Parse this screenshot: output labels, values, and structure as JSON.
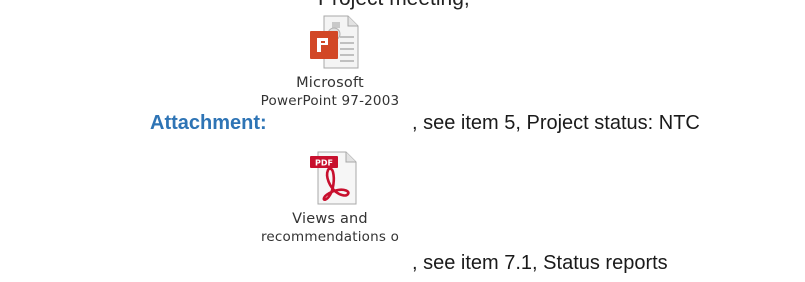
{
  "top_text": "Project meeting,",
  "attachment_label": "Attachment:",
  "attachments": [
    {
      "icon": "powerpoint-file-icon",
      "caption_line1": "Microsoft",
      "caption_line2": "PowerPoint 97-2003",
      "description": ", see item 5, Project status: NTC"
    },
    {
      "icon": "pdf-file-icon",
      "icon_badge": "PDF",
      "caption_line1": "Views and",
      "caption_line2": "recommendations o",
      "description": ", see item 7.1, Status reports"
    }
  ],
  "colors": {
    "label": "#2e74b5",
    "powerpoint": "#d24726",
    "pdf": "#c8102e"
  }
}
